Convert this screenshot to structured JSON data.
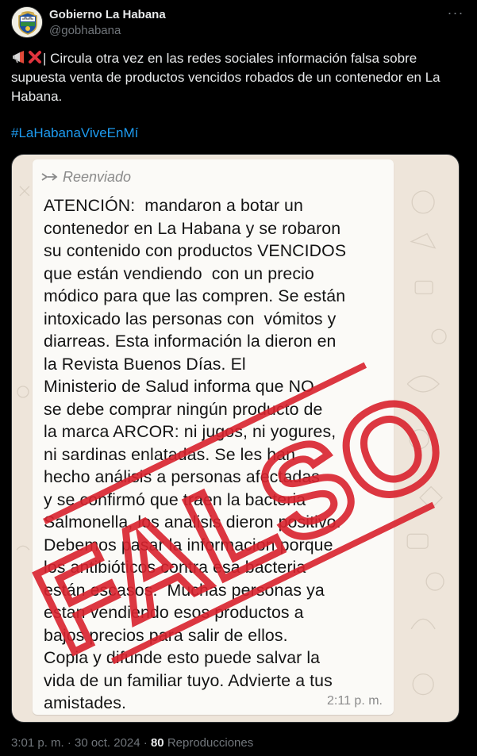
{
  "author": {
    "name": "Gobierno La Habana",
    "handle": "@gobhabana",
    "avatar_icon": "coat-of-arms-icon"
  },
  "tweet": {
    "text": "| Circula otra vez en las redes sociales información falsa sobre supuesta venta de productos vencidos robados de un contenedor en La Habana.",
    "leading_emojis": [
      "megaphone-icon",
      "cross-mark-icon"
    ],
    "hashtag": "#LaHabanaViveEnMí",
    "time": "3:01 p. m.",
    "separator": "·",
    "date": "30 oct. 2024",
    "views": "80",
    "views_label": "Reproducciones"
  },
  "image": {
    "forwarded_label": "Reenviado",
    "message": "ATENCIÓN:  mandaron a botar un\ncontenedor en La Habana y se robaron\nsu contenido con productos VENCIDOS\nque están vendiendo  con un precio\nmódico para que las compren. Se están\nintoxicado las personas con  vómitos y\ndiarreas. Esta información la dieron en\nla Revista Buenos Días. El\nMinisterio de Salud informa que NO\nse debe comprar ningún producto de\nla marca ARCOR: ni jugos, ni yogures,\nni sardinas enlatadas. Se les han\nhecho análisis a personas afectadas\ny se confirmó que traen la bacteria\nSalmonella, los analisis dieron positivo.\nDebemos pasar la informacion porque\nlos antibióticos contra esa bacteria\nestán escasos.  Muchas personas ya\nestan vendiendo esos productos a\nbajos precios para salir de ellos.\nCopia y difunde esto puede salvar la\nvida de un familiar tuyo. Advierte a tus\namistades.",
    "message_time": "2:11 p. m.",
    "stamp_text": "FALSO",
    "stamp_color": "#d9232e"
  },
  "colors": {
    "background": "#000000",
    "text": "#e7e9ea",
    "muted": "#71767b",
    "link": "#1d9bf0",
    "chat_bg": "#eee5da",
    "bubble": "#fbfaf7"
  }
}
